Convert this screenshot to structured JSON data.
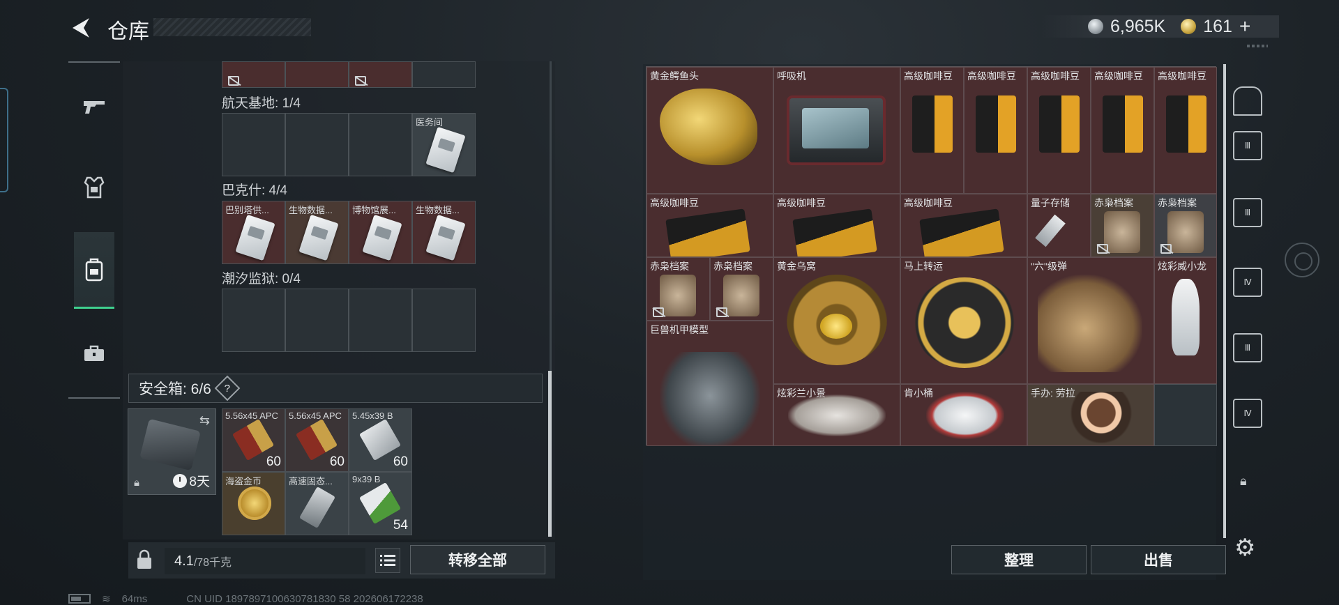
{
  "header": {
    "title": "仓库",
    "currency_silver": "6,965K",
    "currency_gold": "161",
    "currency_add": "+"
  },
  "left_rail": {
    "icons": [
      "gun-icon",
      "armor-icon",
      "backpack-icon",
      "toolbox-icon"
    ],
    "active": "backpack-icon"
  },
  "containers": [
    {
      "label": "航天基地: 1/4",
      "items": [
        "",
        "",
        "",
        "医务间"
      ]
    },
    {
      "label": "巴克什: 4/4",
      "items": [
        "巴别塔供...",
        "生物数据...",
        "博物馆展...",
        "生物数据..."
      ]
    },
    {
      "label": "潮汐监狱: 0/4",
      "items": [
        "",
        "",
        "",
        ""
      ]
    }
  ],
  "safe_box": {
    "label": "安全箱: 6/6",
    "help": "?",
    "timer": "8天",
    "slots": [
      {
        "name": "5.56x45 APC",
        "count": "60"
      },
      {
        "name": "5.56x45 APC",
        "count": "60"
      },
      {
        "name": "5.45x39 B",
        "count": "60"
      },
      {
        "name": "海盗金币",
        "count": ""
      },
      {
        "name": "高速固态...",
        "count": ""
      },
      {
        "name": "9x39 B",
        "count": "54"
      }
    ]
  },
  "bottom_left": {
    "weight_current": "4.1",
    "weight_max": "/78千克",
    "transfer_label": "转移全部"
  },
  "status_bar": {
    "ping": "64ms",
    "uid": "CN UID 1897897100630781830 58 202606172238"
  },
  "stash_items": [
    {
      "name": "黄金鳄鱼头"
    },
    {
      "name": "呼吸机"
    },
    {
      "name": "高级咖啡豆"
    },
    {
      "name": "高级咖啡豆"
    },
    {
      "name": "高级咖啡豆"
    },
    {
      "name": "高级咖啡豆"
    },
    {
      "name": "高级咖啡豆"
    },
    {
      "name": "高级咖啡豆"
    },
    {
      "name": "高级咖啡豆"
    },
    {
      "name": "高级咖啡豆"
    },
    {
      "name": "量子存储"
    },
    {
      "name": "赤枭档案"
    },
    {
      "name": "赤枭档案"
    },
    {
      "name": "赤枭档案"
    },
    {
      "name": "赤枭档案"
    },
    {
      "name": "黄金乌窝"
    },
    {
      "name": "马上转运"
    },
    {
      "name": "\"六\"级弹"
    },
    {
      "name": "炫彩威小龙"
    },
    {
      "name": "巨兽机甲模型"
    },
    {
      "name": "炫彩兰小景"
    },
    {
      "name": "肯小桶"
    },
    {
      "name": "手办: 劳拉"
    }
  ],
  "right_rail": {
    "icons": [
      "helmet-slot-icon",
      "armor-slot-icon",
      "armor-slot-3-icon",
      "backpack-slot-4-icon",
      "vest-slot-icon",
      "safe-slot-icon",
      "lock-icon",
      "gear-icon"
    ],
    "labels": [
      "",
      "Ⅲ",
      "Ⅲ",
      "Ⅳ",
      "Ⅲ",
      "Ⅳ"
    ]
  },
  "bottom_right": {
    "sort_label": "整理",
    "sell_label": "出售"
  }
}
